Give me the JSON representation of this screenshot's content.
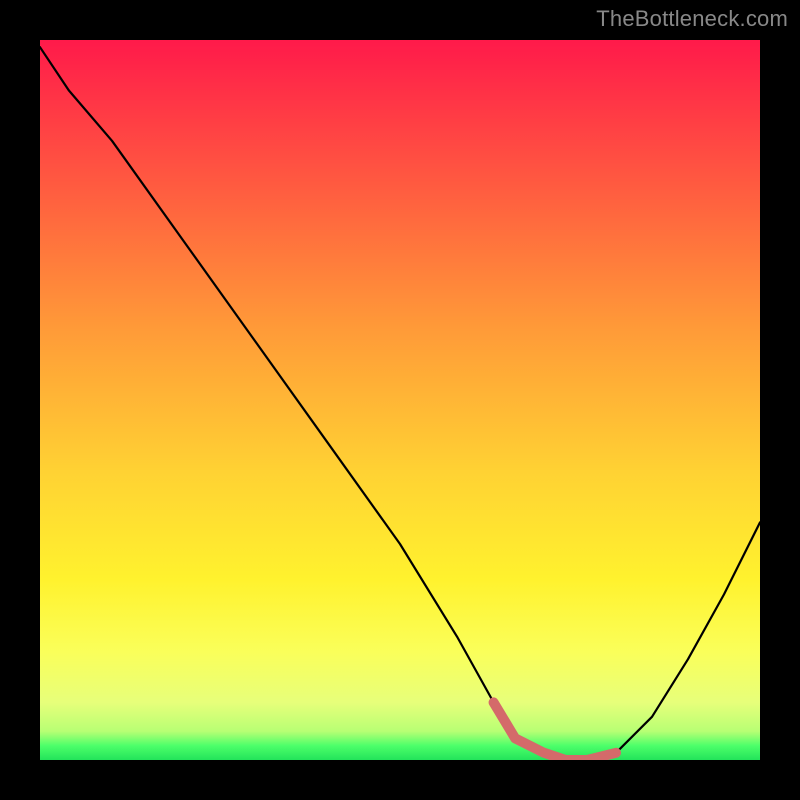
{
  "watermark": "TheBottleneck.com",
  "chart_data": {
    "type": "line",
    "title": "",
    "xlabel": "",
    "ylabel": "",
    "xlim": [
      0,
      100
    ],
    "ylim": [
      0,
      100
    ],
    "series": [
      {
        "name": "bottleneck-curve",
        "x": [
          0,
          4,
          10,
          20,
          30,
          40,
          50,
          58,
          63,
          66,
          70,
          73,
          76,
          80,
          85,
          90,
          95,
          100
        ],
        "y": [
          99,
          93,
          86,
          72,
          58,
          44,
          30,
          17,
          8,
          3,
          1,
          0,
          0,
          1,
          6,
          14,
          23,
          33
        ]
      },
      {
        "name": "optimal-range-highlight",
        "x": [
          63,
          66,
          70,
          73,
          76,
          80
        ],
        "y": [
          8,
          3,
          1,
          0,
          0,
          1
        ]
      }
    ],
    "colors": {
      "curve": "#000000",
      "highlight": "#d46a6a",
      "gradient_top": "#ff1a4a",
      "gradient_bottom": "#22e35a"
    }
  }
}
